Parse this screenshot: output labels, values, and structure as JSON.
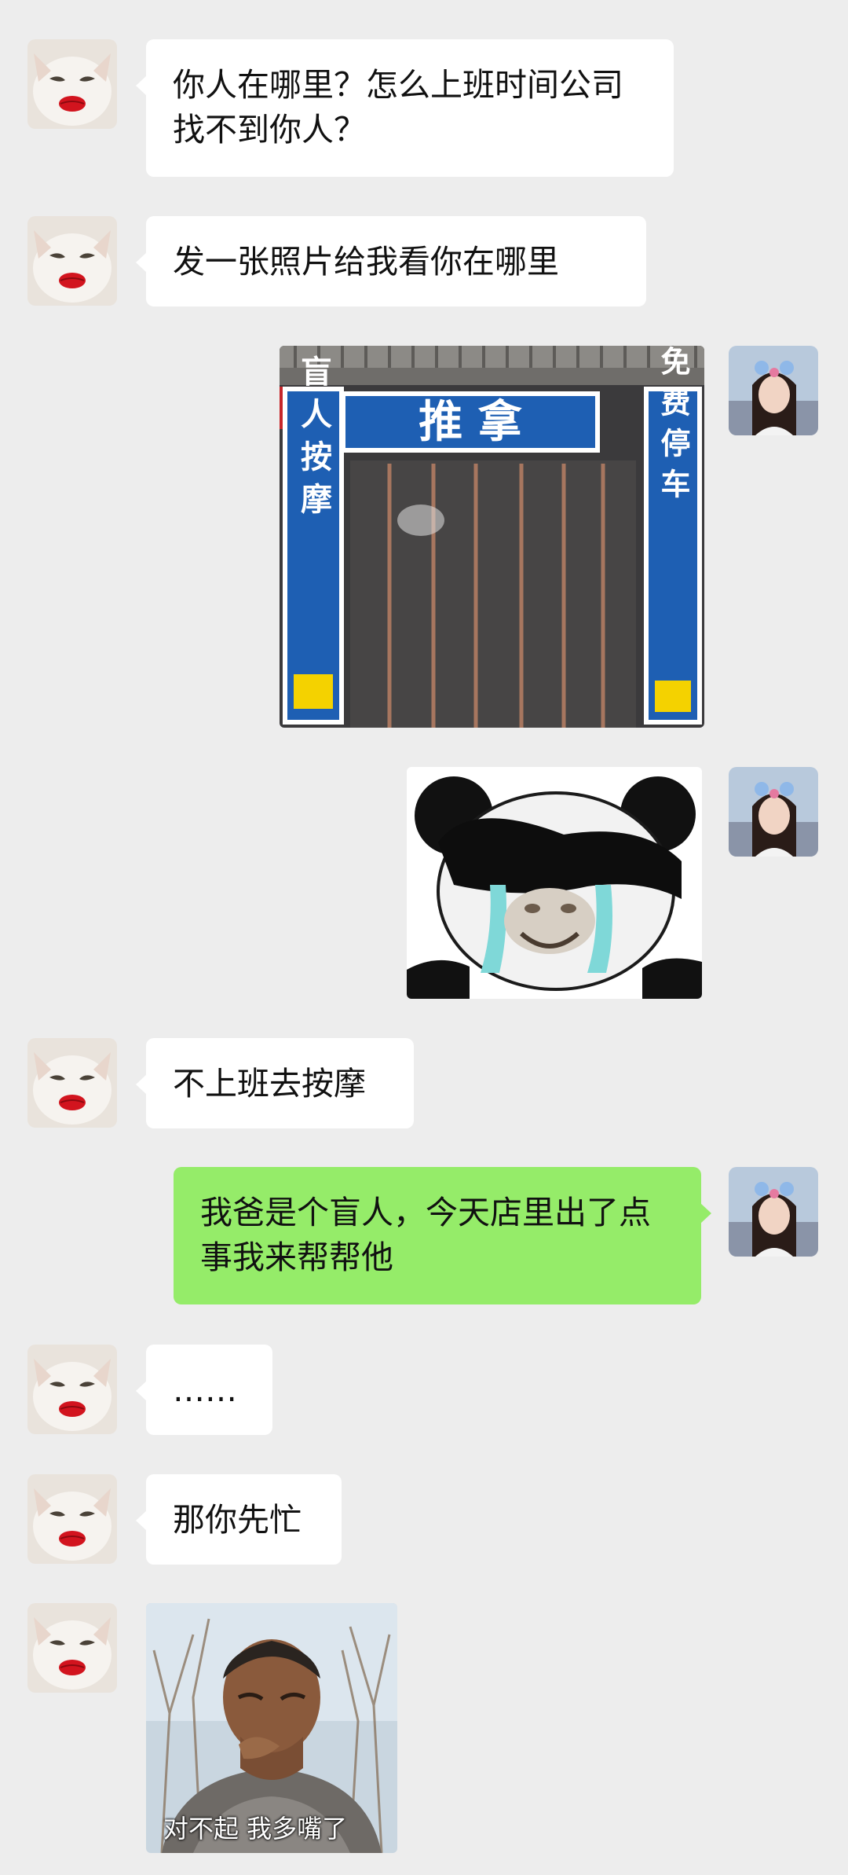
{
  "messages": [
    {
      "sender": "boss",
      "type": "text",
      "text": "你人在哪里？怎么上班时间公司找不到你人？"
    },
    {
      "sender": "boss",
      "type": "text",
      "text": "发一张照片给我看你在哪里"
    },
    {
      "sender": "me",
      "type": "image",
      "content": "massage-shop-photo",
      "sign": {
        "main": "推 拿",
        "left_column": "盲人按摩",
        "right_column": "免费停车"
      }
    },
    {
      "sender": "me",
      "type": "sticker",
      "content": "crying-panda-sticker"
    },
    {
      "sender": "boss",
      "type": "text",
      "text": "不上班去按摩"
    },
    {
      "sender": "me",
      "type": "text",
      "text": "我爸是个盲人，今天店里出了点事我来帮帮他"
    },
    {
      "sender": "boss",
      "type": "text",
      "text": "……"
    },
    {
      "sender": "boss",
      "type": "text",
      "text": "那你先忙"
    },
    {
      "sender": "me_as_boss",
      "type": "sticker",
      "content": "crying-man-sticker",
      "caption": "对不起 我多嘴了"
    }
  ],
  "colors": {
    "background": "#ededed",
    "left_bubble": "#ffffff",
    "right_bubble": "#95ec69",
    "sign_blue": "#1e5fb3"
  }
}
